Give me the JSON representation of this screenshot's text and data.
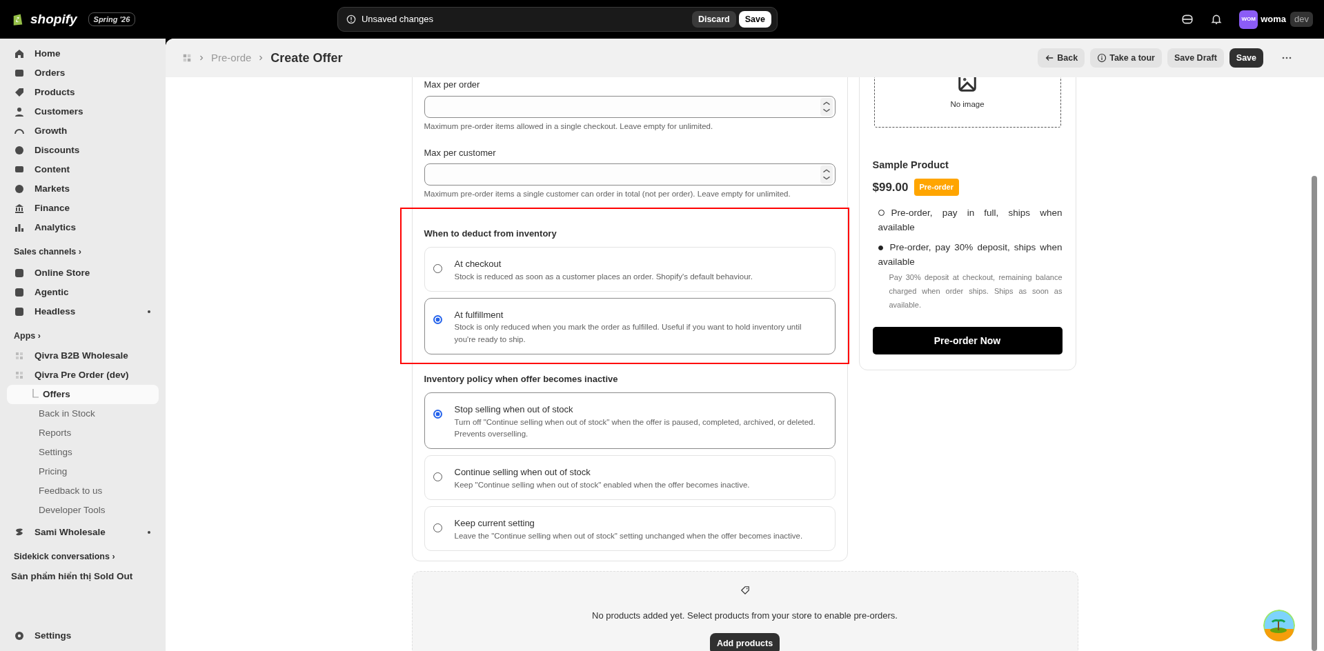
{
  "topbar": {
    "brand": "shopify",
    "edition": "Spring '26",
    "banner": {
      "text": "Unsaved changes",
      "discard": "Discard",
      "save": "Save"
    },
    "user": {
      "initials": "WOM",
      "name": "woma",
      "tag": "dev"
    }
  },
  "sidebar": {
    "items": [
      {
        "kind": "nav",
        "label": "Home"
      },
      {
        "kind": "nav",
        "label": "Orders"
      },
      {
        "kind": "nav",
        "label": "Products"
      },
      {
        "kind": "nav",
        "label": "Customers"
      },
      {
        "kind": "nav",
        "label": "Growth"
      },
      {
        "kind": "nav",
        "label": "Discounts"
      },
      {
        "kind": "nav",
        "label": "Content"
      },
      {
        "kind": "nav",
        "label": "Markets"
      },
      {
        "kind": "nav",
        "label": "Finance"
      },
      {
        "kind": "nav",
        "label": "Analytics"
      },
      {
        "kind": "heading",
        "label": "Sales channels ›"
      },
      {
        "kind": "nav",
        "label": "Online Store"
      },
      {
        "kind": "nav",
        "label": "Agentic"
      },
      {
        "kind": "nav",
        "label": "Headless",
        "dot": true
      },
      {
        "kind": "heading",
        "label": "Apps ›"
      },
      {
        "kind": "app",
        "label": "Qivra B2B Wholesale"
      },
      {
        "kind": "app",
        "label": "Qivra Pre Order (dev)"
      },
      {
        "kind": "sub",
        "label": "Offers",
        "selected": true
      },
      {
        "kind": "sub",
        "label": "Back in Stock",
        "selected": false
      },
      {
        "kind": "sub",
        "label": "Reports",
        "selected": false
      },
      {
        "kind": "sub",
        "label": "Settings",
        "selected": false
      },
      {
        "kind": "sub",
        "label": "Pricing",
        "selected": false
      },
      {
        "kind": "sub",
        "label": "Feedback to us",
        "selected": false
      },
      {
        "kind": "sub",
        "label": "Developer Tools",
        "selected": false
      },
      {
        "kind": "nav",
        "label": "Sami Wholesale",
        "dot": true
      },
      {
        "kind": "heading",
        "label": "Sidekick conversations ›"
      },
      {
        "kind": "text",
        "label": "Sản phẩm hiển thị Sold Out"
      }
    ],
    "footer": "Settings"
  },
  "header": {
    "breadcrumb": "Pre-orde",
    "title": "Create Offer",
    "back": "Back",
    "tour": "Take a tour",
    "draft": "Save Draft",
    "save": "Save"
  },
  "form": {
    "fields": [
      {
        "label": "Max per order",
        "hint": "Maximum pre-order items allowed in a single checkout. Leave empty for unlimited."
      },
      {
        "label": "Max per customer",
        "hint": "Maximum pre-order items a single customer can order in total (not per order). Leave empty for unlimited."
      }
    ],
    "sections": [
      {
        "title": "When to deduct from inventory",
        "highlighted": true,
        "options": [
          {
            "title": "At checkout",
            "description": "Stock is reduced as soon as a customer places an order. Shopify's default behaviour.",
            "selected": false
          },
          {
            "title": "At fulfillment",
            "description": "Stock is only reduced when you mark the order as fulfilled. Useful if you want to hold inventory until you're ready to ship.",
            "selected": true
          }
        ]
      },
      {
        "title": "Inventory policy when offer becomes inactive",
        "highlighted": false,
        "options": [
          {
            "title": "Stop selling when out of stock",
            "description": "Turn off \"Continue selling when out of stock\" when the offer is paused, completed, archived, or deleted. Prevents overselling.",
            "selected": true
          },
          {
            "title": "Continue selling when out of stock",
            "description": "Keep \"Continue selling when out of stock\" enabled when the offer becomes inactive.",
            "selected": false
          },
          {
            "title": "Keep current setting",
            "description": "Leave the \"Continue selling when out of stock\" setting unchanged when the offer becomes inactive.",
            "selected": false
          }
        ]
      }
    ]
  },
  "preview": {
    "image_text": "No image",
    "product": "Sample Product",
    "price": "$99.00",
    "badge": "Pre-order",
    "options": [
      {
        "label": "Pre-order, pay in full, ships when available",
        "selected": false
      },
      {
        "label": "Pre-order, pay 30% deposit, ships when available",
        "selected": true,
        "description": "Pay 30% deposit at checkout, remaining balance charged when order ships. Ships as soon as available."
      }
    ],
    "button": "Pre-order Now"
  },
  "products": {
    "empty_text": "No products added yet. Select products from your store to enable pre-orders.",
    "button": "Add products"
  }
}
